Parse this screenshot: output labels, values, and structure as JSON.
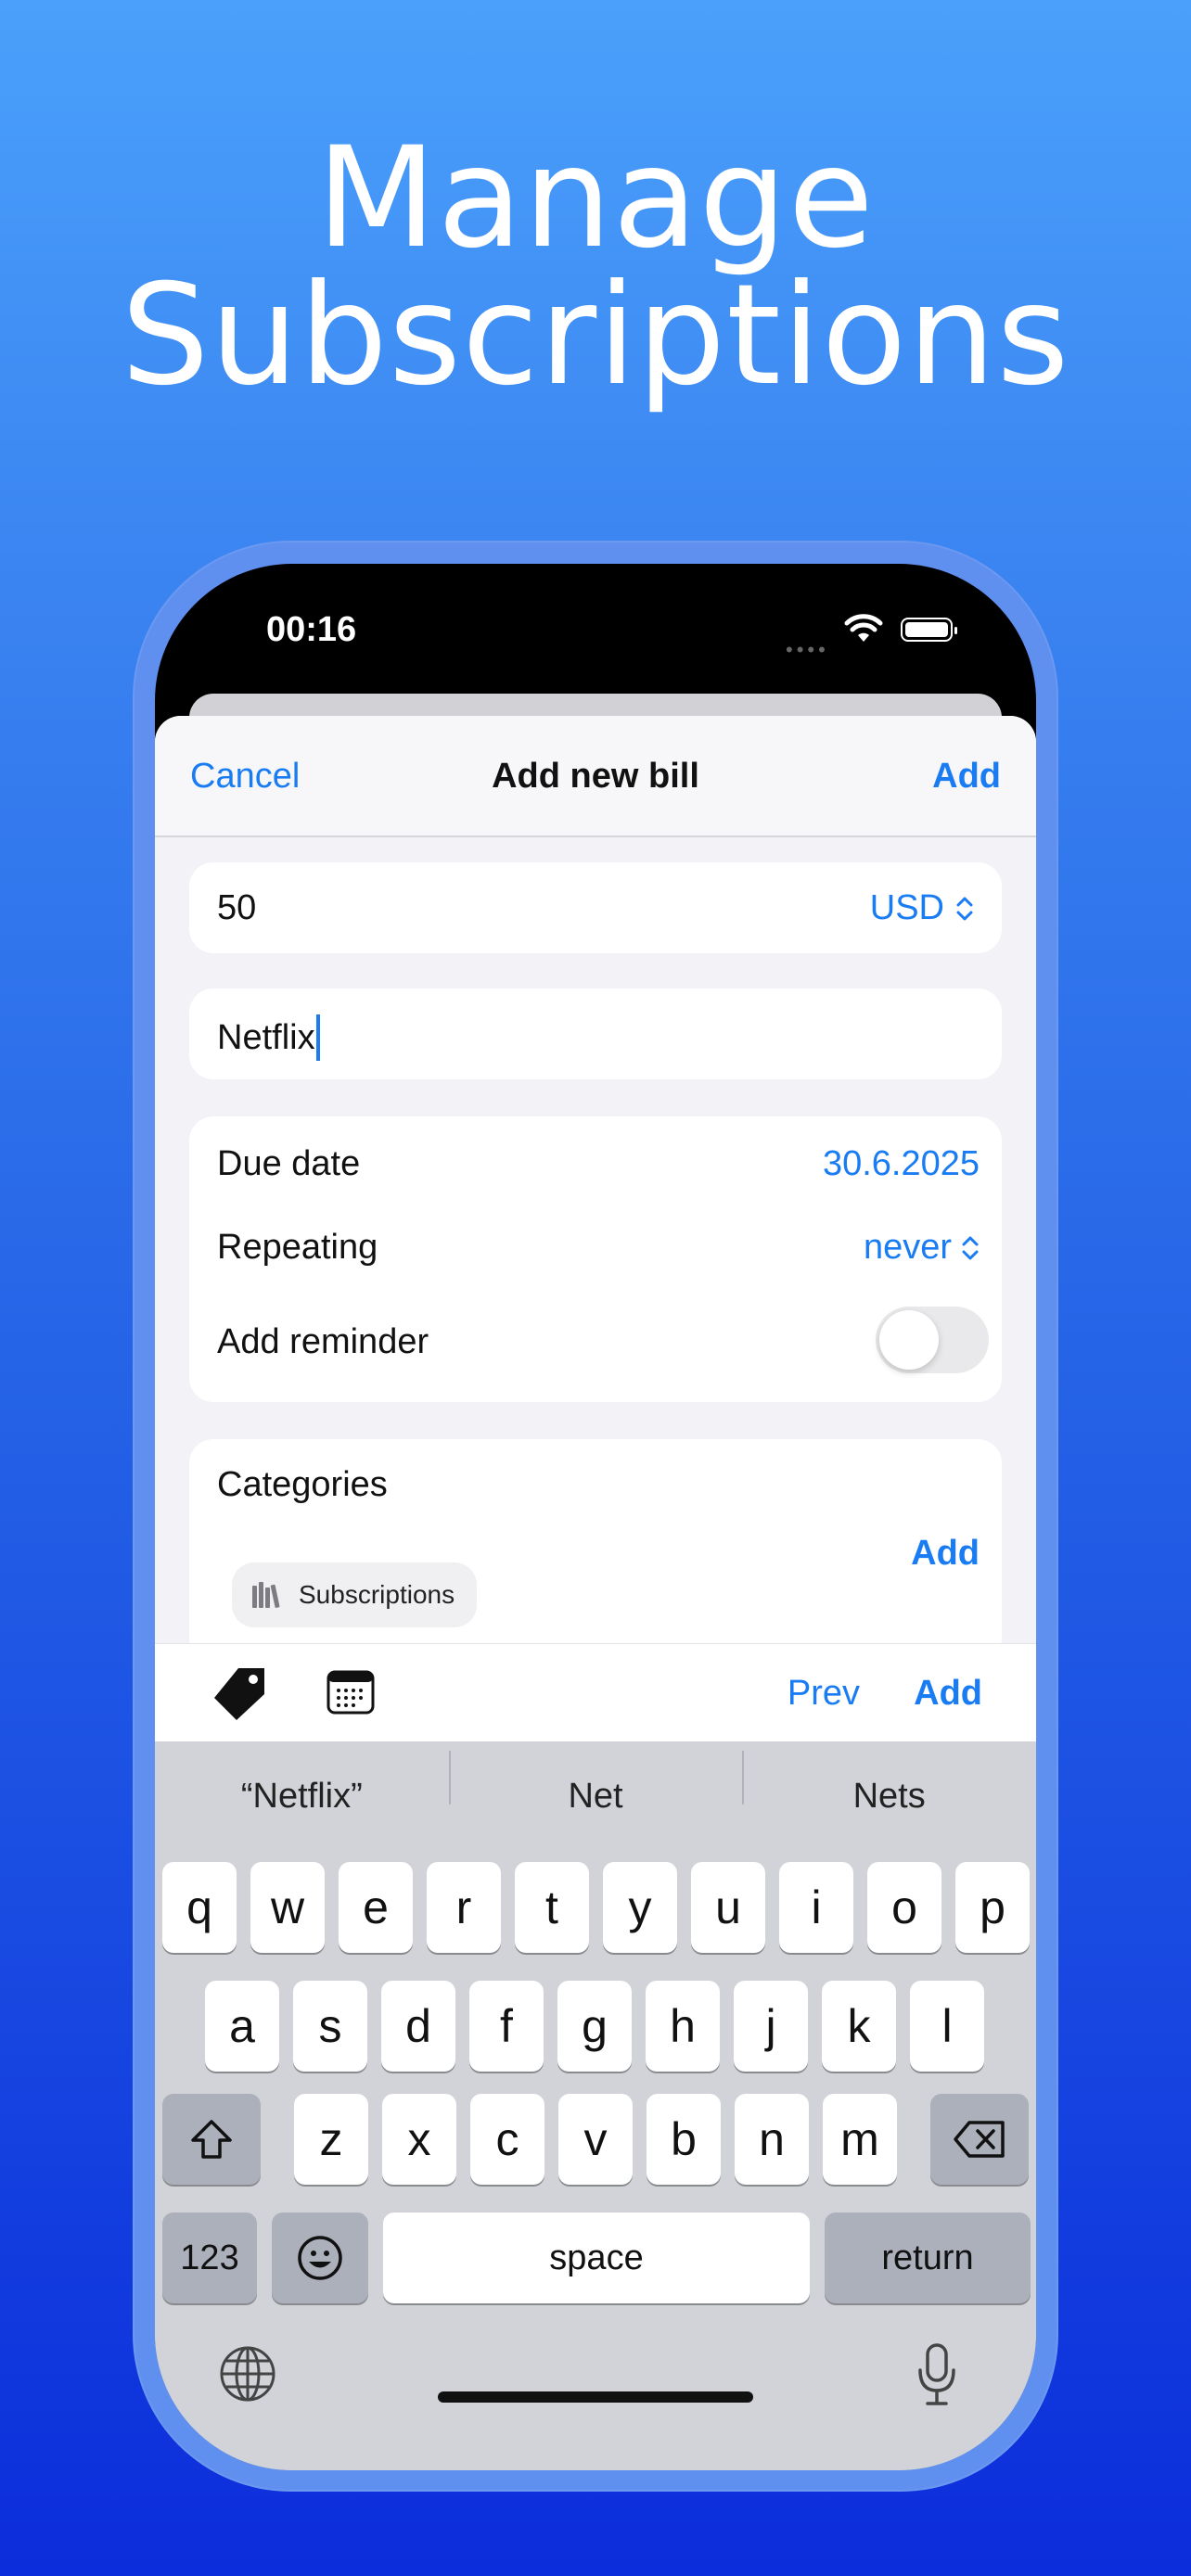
{
  "headline": {
    "line1": "Manage",
    "line2": "Subscriptions"
  },
  "status_bar": {
    "time": "00:16",
    "signal": "••••"
  },
  "nav": {
    "cancel": "Cancel",
    "title": "Add new bill",
    "add": "Add"
  },
  "form": {
    "amount": "50",
    "currency": "USD",
    "name": "Netflix",
    "due_date_label": "Due date",
    "due_date_value": "30.6.2025",
    "repeating_label": "Repeating",
    "repeating_value": "never",
    "reminder_label": "Add reminder",
    "reminder_on": false,
    "categories_title": "Categories",
    "categories_add": "Add",
    "category_chip": "Subscriptions"
  },
  "accessory": {
    "prev": "Prev",
    "add": "Add"
  },
  "keyboard": {
    "suggestions": [
      "“Netflix”",
      "Net",
      "Nets"
    ],
    "row1": [
      "q",
      "w",
      "e",
      "r",
      "t",
      "y",
      "u",
      "i",
      "o",
      "p"
    ],
    "row2": [
      "a",
      "s",
      "d",
      "f",
      "g",
      "h",
      "j",
      "k",
      "l"
    ],
    "row3": [
      "z",
      "x",
      "c",
      "v",
      "b",
      "n",
      "m"
    ],
    "numbers_key": "123",
    "space_key": "space",
    "return_key": "return"
  },
  "colors": {
    "accent": "#1a7cf2",
    "background_top": "#4aa0fb",
    "background_bottom": "#0b2ddb"
  }
}
